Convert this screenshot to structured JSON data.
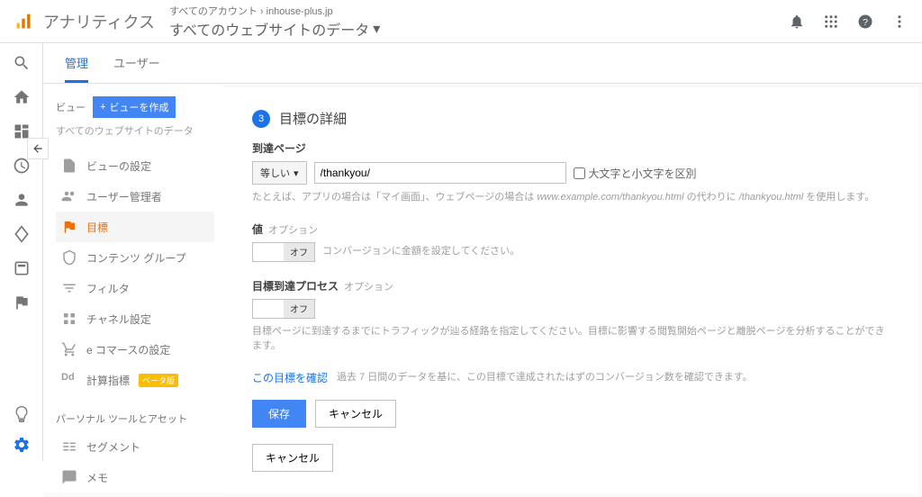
{
  "header": {
    "brand": "アナリティクス",
    "breadcrumb_prefix": "すべてのアカウント",
    "breadcrumb_account": "inhouse-plus.jp",
    "view_title": "すべてのウェブサイトのデータ"
  },
  "tabs": {
    "admin": "管理",
    "user": "ユーザー"
  },
  "viewcol": {
    "label": "ビュー",
    "create": "ビューを作成",
    "sub": "すべてのウェブサイトのデータ",
    "items": [
      {
        "label": "ビューの設定"
      },
      {
        "label": "ユーザー管理者"
      },
      {
        "label": "目標"
      },
      {
        "label": "コンテンツ グループ"
      },
      {
        "label": "フィルタ"
      },
      {
        "label": "チャネル設定"
      },
      {
        "label": "e コマースの設定"
      },
      {
        "label": "計算指標",
        "badge": "ベータ版"
      }
    ],
    "section": "パーソナル ツールとアセット",
    "items2": [
      {
        "label": "セグメント"
      },
      {
        "label": "メモ"
      }
    ]
  },
  "goal": {
    "step_num": "3",
    "step_title": "目標の詳細",
    "dest_label": "到達ページ",
    "match_type": "等しい",
    "dest_value": "/thankyou/",
    "case_label": "大文字と小文字を区別",
    "dest_help_a": "たとえば、アプリの場合は「マイ画面」、ウェブページの場合は ",
    "dest_help_i1": "www.example.com/thankyou.html",
    "dest_help_b": " の代わりに ",
    "dest_help_i2": "/thankyou.html",
    "dest_help_c": " を使用します。",
    "value_label": "値",
    "option_text": "オプション",
    "toggle_off": "オフ",
    "value_help": "コンバージョンに金額を設定してください。",
    "funnel_label": "目標到達プロセス",
    "funnel_help": "目標ページに到達するまでにトラフィックが辿る経路を指定してください。目標に影響する閲覧開始ページと離脱ページを分析することができます。",
    "verify": "この目標を確認",
    "verify_help": "過去 7 日間のデータを基に、この目標で達成されたはずのコンバージョン数を確認できます。",
    "save": "保存",
    "cancel": "キャンセル",
    "cancel2": "キャンセル"
  }
}
